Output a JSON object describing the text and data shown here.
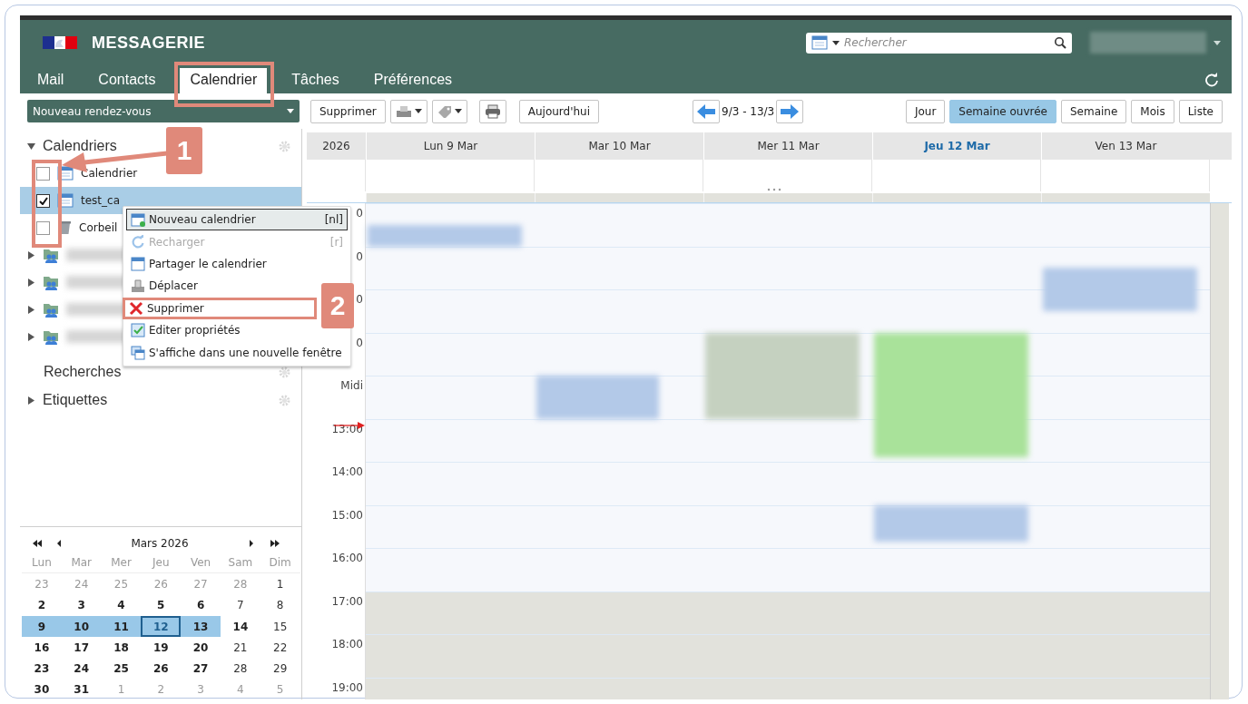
{
  "header": {
    "title": "MESSAGERIE",
    "search_placeholder": "Rechercher"
  },
  "tabs": [
    {
      "label": "Mail",
      "selected": false,
      "annotated": false
    },
    {
      "label": "Contacts",
      "selected": false,
      "annotated": false
    },
    {
      "label": "Calendrier",
      "selected": true,
      "annotated": true
    },
    {
      "label": "Tâches",
      "selected": false,
      "annotated": false
    },
    {
      "label": "Préférences",
      "selected": false,
      "annotated": false
    }
  ],
  "toolbar": {
    "new_label": "Nouveau rendez-vous",
    "delete_label": "Supprimer",
    "today_label": "Aujourd'hui",
    "range": "9/3 - 13/3"
  },
  "views": [
    {
      "label": "Jour",
      "selected": false
    },
    {
      "label": "Semaine ouvrée",
      "selected": true
    },
    {
      "label": "Semaine",
      "selected": false
    },
    {
      "label": "Mois",
      "selected": false
    },
    {
      "label": "Liste",
      "selected": false
    }
  ],
  "sidebar": {
    "calendars_title": "Calendriers",
    "calendars_expanded": true,
    "calendars": [
      {
        "kind": "calendar",
        "label": "Calendrier",
        "checked": false,
        "selected": false
      },
      {
        "kind": "calendar",
        "label": "test_ca",
        "checked": true,
        "selected": true
      },
      {
        "kind": "trash",
        "label": "Corbeil",
        "checked": false,
        "selected": false
      },
      {
        "kind": "shared"
      },
      {
        "kind": "shared"
      },
      {
        "kind": "shared"
      },
      {
        "kind": "shared"
      }
    ],
    "searches_title": "Recherches",
    "tags_title": "Etiquettes",
    "tags_expanded": false
  },
  "context_menu": [
    {
      "kind": "new",
      "label": "Nouveau calendrier",
      "shortcut": "[nl]",
      "selected": true,
      "disabled": false,
      "annotated": false
    },
    {
      "kind": "reload",
      "label": "Recharger",
      "shortcut": "[r]",
      "selected": false,
      "disabled": true,
      "annotated": false
    },
    {
      "kind": "share",
      "label": "Partager le calendrier",
      "selected": false,
      "disabled": false,
      "annotated": false
    },
    {
      "kind": "move",
      "label": "Déplacer",
      "selected": false,
      "disabled": false,
      "annotated": false
    },
    {
      "kind": "delete",
      "label": "Supprimer",
      "selected": false,
      "disabled": false,
      "annotated": true
    },
    {
      "kind": "edit",
      "label": "Editer propriétés",
      "selected": false,
      "disabled": false,
      "annotated": false
    },
    {
      "kind": "window",
      "label": "S'affiche dans une nouvelle fenêtre",
      "selected": false,
      "disabled": false,
      "annotated": false
    }
  ],
  "callouts": [
    {
      "number": "1"
    },
    {
      "number": "2"
    }
  ],
  "mini_calendar": {
    "title": "Mars 2026",
    "weekdays": [
      "Lun",
      "Mar",
      "Mer",
      "Jeu",
      "Ven",
      "Sam",
      "Dim"
    ],
    "weeks": [
      [
        {
          "text": "23",
          "kind": "other"
        },
        {
          "text": "24",
          "kind": "other"
        },
        {
          "text": "25",
          "kind": "other"
        },
        {
          "text": "26",
          "kind": "other"
        },
        {
          "text": "27",
          "kind": "other"
        },
        {
          "text": "28",
          "kind": "other"
        },
        {
          "text": "1",
          "kind": "weekend"
        }
      ],
      [
        {
          "text": "2",
          "kind": "weekday"
        },
        {
          "text": "3",
          "kind": "weekday"
        },
        {
          "text": "4",
          "kind": "weekday"
        },
        {
          "text": "5",
          "kind": "weekday"
        },
        {
          "text": "6",
          "kind": "weekday"
        },
        {
          "text": "7",
          "kind": "weekend"
        },
        {
          "text": "8",
          "kind": "weekend"
        }
      ],
      [
        {
          "text": "9",
          "kind": "weekday",
          "selected": true
        },
        {
          "text": "10",
          "kind": "weekday",
          "selected": true
        },
        {
          "text": "11",
          "kind": "weekday",
          "selected": true
        },
        {
          "text": "12",
          "kind": "weekday",
          "selected": true,
          "today": true
        },
        {
          "text": "13",
          "kind": "weekday",
          "selected": true
        },
        {
          "text": "14",
          "kind": "weekday"
        },
        {
          "text": "15",
          "kind": "weekend"
        }
      ],
      [
        {
          "text": "16",
          "kind": "weekday"
        },
        {
          "text": "17",
          "kind": "weekday"
        },
        {
          "text": "18",
          "kind": "weekday"
        },
        {
          "text": "19",
          "kind": "weekday"
        },
        {
          "text": "20",
          "kind": "weekday"
        },
        {
          "text": "21",
          "kind": "weekend"
        },
        {
          "text": "22",
          "kind": "weekend"
        }
      ],
      [
        {
          "text": "23",
          "kind": "weekday"
        },
        {
          "text": "24",
          "kind": "weekday"
        },
        {
          "text": "25",
          "kind": "weekday"
        },
        {
          "text": "26",
          "kind": "weekday"
        },
        {
          "text": "27",
          "kind": "weekday"
        },
        {
          "text": "28",
          "kind": "weekend"
        },
        {
          "text": "29",
          "kind": "weekend"
        }
      ],
      [
        {
          "text": "30",
          "kind": "weekday"
        },
        {
          "text": "31",
          "kind": "weekday"
        },
        {
          "text": "1",
          "kind": "other"
        },
        {
          "text": "2",
          "kind": "other"
        },
        {
          "text": "3",
          "kind": "other"
        },
        {
          "text": "4",
          "kind": "other"
        },
        {
          "text": "5",
          "kind": "other"
        }
      ]
    ]
  },
  "week": {
    "year": "2026",
    "hours": [
      {
        "label": "0",
        "now": false,
        "off_hours": false
      },
      {
        "label": "0",
        "now": false,
        "off_hours": false
      },
      {
        "label": "0",
        "now": false,
        "off_hours": false
      },
      {
        "label": "0",
        "now": false,
        "off_hours": false
      },
      {
        "label": "Midi",
        "now": false,
        "off_hours": false
      },
      {
        "label": "13:00",
        "now": true,
        "off_hours": false
      },
      {
        "label": "14:00",
        "now": false,
        "off_hours": false
      },
      {
        "label": "15:00",
        "now": false,
        "off_hours": false
      },
      {
        "label": "16:00",
        "now": false,
        "off_hours": false
      },
      {
        "label": "17:00",
        "now": false,
        "off_hours": true
      },
      {
        "label": "18:00",
        "now": false,
        "off_hours": true
      },
      {
        "label": "19:00",
        "now": false,
        "off_hours": true
      }
    ],
    "days": [
      {
        "label": "Lun 9 Mar",
        "today": false
      },
      {
        "label": "Mar 10 Mar",
        "today": false
      },
      {
        "label": "Mer 11 Mar",
        "today": false
      },
      {
        "label": "Jeu 12 Mar",
        "today": true
      },
      {
        "label": "Ven 13 Mar",
        "today": false
      }
    ]
  }
}
